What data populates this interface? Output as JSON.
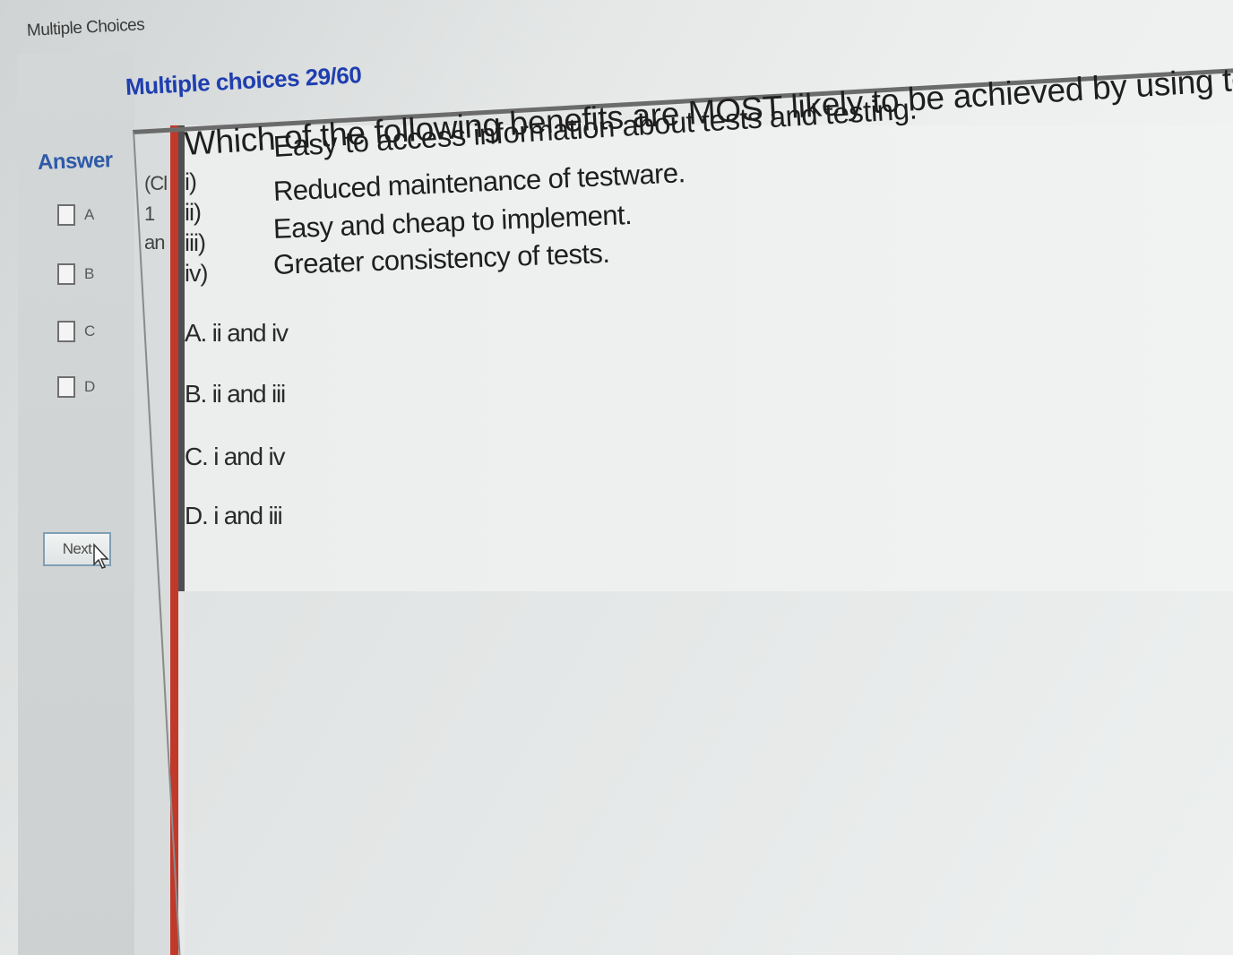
{
  "window": {
    "title": "Multiple Choices"
  },
  "quiz": {
    "heading": "Multiple choices 29/60"
  },
  "answer_panel": {
    "label": "Answer",
    "choices": [
      "A",
      "B",
      "C",
      "D"
    ],
    "next_label": "Next"
  },
  "gutter": [
    "(Cl",
    "1",
    "an"
  ],
  "question": {
    "text_line_1": "Which of the following benefits are MOST likely to be achieved by using test tools?",
    "text_line_2": "Easy to access information about tests and testing.",
    "statements": [
      {
        "numeral": "i)",
        "text": ""
      },
      {
        "numeral": "ii)",
        "text": "Reduced maintenance of testware."
      },
      {
        "numeral": "iii)",
        "text": "Easy and cheap to implement."
      },
      {
        "numeral": "iv)",
        "text": "Greater consistency of tests."
      }
    ],
    "options": [
      {
        "letter": "A.",
        "text": "ii and iv"
      },
      {
        "letter": "B.",
        "text": "ii and iii"
      },
      {
        "letter": "C.",
        "text": "i and iv"
      },
      {
        "letter": "D.",
        "text": "i and iii"
      }
    ]
  }
}
